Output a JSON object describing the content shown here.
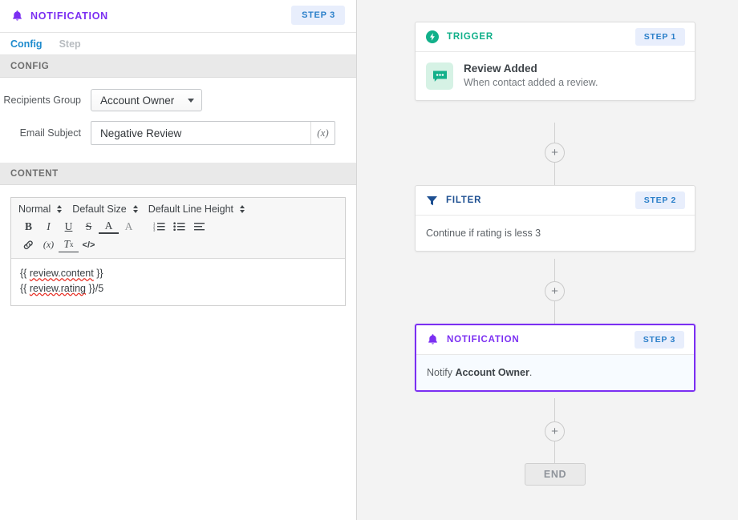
{
  "panel": {
    "title": "NOTIFICATION",
    "step_badge": "STEP 3",
    "bell_icon": "bell-icon",
    "tabs": [
      {
        "label": "Config",
        "active": true
      },
      {
        "label": "Step",
        "active": false
      }
    ],
    "config_section": {
      "header": "CONFIG",
      "fields": [
        {
          "label": "Recipients Group",
          "type": "select",
          "value": "Account Owner"
        },
        {
          "label": "Email Subject",
          "type": "text",
          "value": "Negative Review",
          "variable_button": "(x)"
        }
      ]
    },
    "content_section": {
      "header": "CONTENT",
      "editor": {
        "dropdowns": [
          {
            "label": "Normal",
            "name": "format-select"
          },
          {
            "label": "Default Size",
            "name": "size-select"
          },
          {
            "label": "Default Line Height",
            "name": "line-height-select"
          }
        ],
        "buttons_row2": [
          {
            "glyph": "B",
            "name": "bold-icon"
          },
          {
            "glyph": "I",
            "name": "italic-icon"
          },
          {
            "glyph": "U",
            "name": "underline-icon"
          },
          {
            "glyph": "S",
            "name": "strikethrough-icon"
          },
          {
            "glyph": "A",
            "name": "text-color-icon"
          },
          {
            "glyph": "A",
            "name": "highlight-color-icon"
          },
          {
            "glyph": "",
            "name": "ordered-list-icon"
          },
          {
            "glyph": "",
            "name": "bullet-list-icon"
          },
          {
            "glyph": "",
            "name": "align-icon"
          }
        ],
        "buttons_row3": [
          {
            "glyph": "",
            "name": "link-icon"
          },
          {
            "glyph": "(x)",
            "name": "variable-icon"
          },
          {
            "glyph": "Tx",
            "name": "clear-format-icon"
          },
          {
            "glyph": "</>",
            "name": "code-view-icon"
          }
        ],
        "content_lines": [
          {
            "prefix": "{{ ",
            "variable": "review.content",
            "suffix": " }}"
          },
          {
            "prefix": "{{ ",
            "variable": "review.rating",
            "suffix": " }}/5"
          }
        ]
      }
    }
  },
  "canvas": {
    "nodes": [
      {
        "kind": "TRIGGER",
        "badge": "STEP 1",
        "icon": "lightning-bolt-icon",
        "body_icon": "chat-bubble-icon",
        "name": "Review Added",
        "desc": "When contact added a review.",
        "selected": false
      },
      {
        "kind": "FILTER",
        "badge": "STEP 2",
        "icon": "funnel-icon",
        "text": "Continue if rating is less 3",
        "selected": false
      },
      {
        "kind": "NOTIFICATION",
        "badge": "STEP 3",
        "icon": "bell-icon",
        "text_prefix": "Notify ",
        "text_bold": "Account Owner",
        "text_suffix": ".",
        "selected": true
      }
    ],
    "add_button": "+",
    "end_label": "END"
  },
  "colors": {
    "purple": "#7b2ff2",
    "badge_blue": "#2a7fc9",
    "badge_bg": "#e8eefc",
    "trigger_green": "#12b08a",
    "filter_blue": "#1d4f91",
    "canvas_bg": "#f3f3f3"
  }
}
